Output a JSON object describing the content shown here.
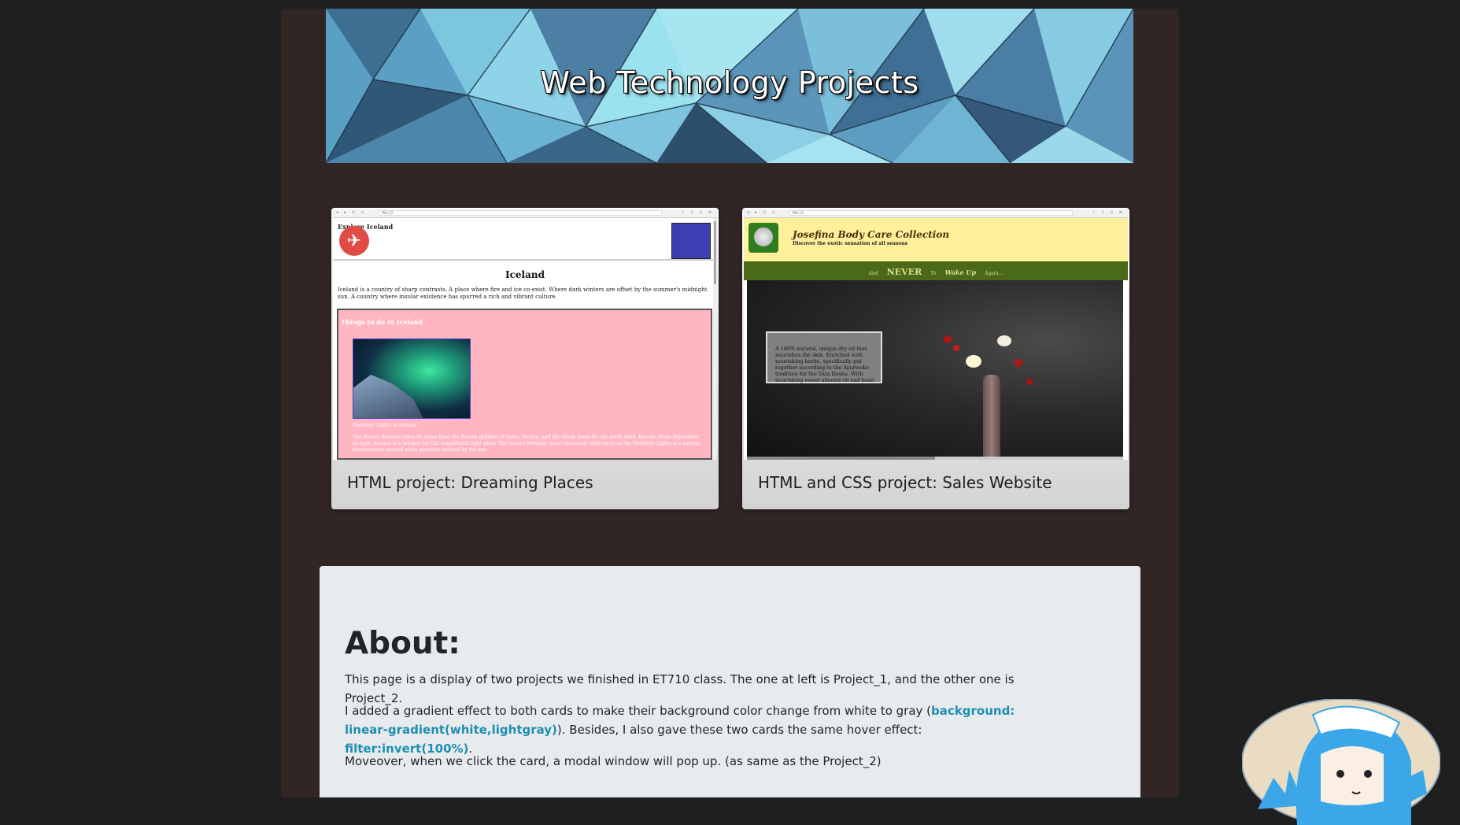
{
  "banner": {
    "title": "Web Technology Projects"
  },
  "cards": [
    {
      "title": "HTML project: Dreaming Places",
      "preview": {
        "explore": "Explore Iceland",
        "heading": "Iceland",
        "intro": "Iceland is a country of sharp contrasts. A place where fire and ice co-exist. Where dark winters are offset by the summer's midnight sun. A country where insular existence has spurred a rich and vibrant culture.",
        "section": "Things to do in Iceland",
        "caption": "Northern Lights in Iceland",
        "para": "The Aurora Borealis takes its name from the Roman goddess of dawn, Aurora, and the Greek name for the north wind, Boreas. From September to April, Iceland is a hotspot for this magnificent light show. The Aurora Borealis, more commonly referred to as the Northern Lights is a natural phenomenon created when particles emitted by the sun"
      }
    },
    {
      "title": "HTML and CSS project: Sales Website",
      "preview": {
        "brand": "Josefina Body Care Collection",
        "tagline": "Discover the exotic sensation of all seasons",
        "nav_and": "And",
        "nav_never": "NEVER",
        "nav_to": "To",
        "nav_wake": "Wake Up",
        "nav_again": "Again...",
        "box": "A 100% natural, unique dry oil that nourishes the skin. Enriched with nourishing herbs, specifically put together according to the Ayurvedic tradition for the Vata Dosha. With nourishing sweet almond oil and basil."
      }
    }
  ],
  "about": {
    "heading": "About:",
    "p1": "This page is a display of two projects we finished in ET710 class. The one at left is Project_1, and the other one is Project_2.",
    "p2_a": "I added a gradient effect to both cards to make their background color change from white to gray (",
    "p2_code1": "background: linear-gradient(white,lightgray)",
    "p2_b": "). Besides, I also gave these two cards the same hover effect: ",
    "p2_code2": "filter:invert(100%)",
    "p2_c": ".",
    "p3": "Moveover, when we click the card, a modal window will pop up. (as same as the Project_2)"
  },
  "colors": {
    "page_bg": "#1f1f1f",
    "container_bg": "#312624",
    "about_bg": "#e8ebee",
    "code_accent": "#1e8fb0"
  }
}
